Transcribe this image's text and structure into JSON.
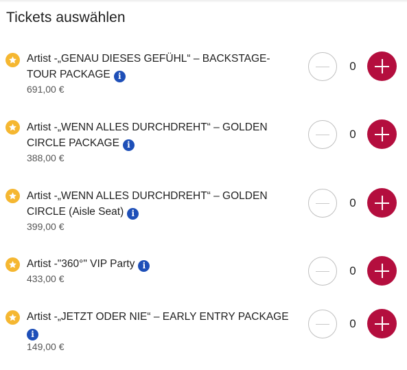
{
  "title": "Tickets auswählen",
  "tickets": [
    {
      "name": "Artist -„GENAU DIESES GEFÜHL“ – BACKSTAGE-TOUR PACKAGE",
      "price": "691,00 €",
      "quantity": "0"
    },
    {
      "name": "Artist -„WENN ALLES DURCHDREHT“ – GOLDEN CIRCLE PACKAGE",
      "price": "388,00 €",
      "quantity": "0"
    },
    {
      "name": "Artist -„WENN ALLES DURCHDREHT“ – GOLDEN CIRCLE (Aisle Seat)",
      "price": "399,00 €",
      "quantity": "0"
    },
    {
      "name": "Artist -\"360°\" VIP Party",
      "price": "433,00 €",
      "quantity": "0"
    },
    {
      "name": "Artist -„JETZT ODER NIE“ – EARLY ENTRY PACKAGE",
      "price": "149,00 €",
      "quantity": "0"
    }
  ],
  "icons": {
    "star": "star-icon",
    "info": "info-icon",
    "info_glyph": "i",
    "minus": "minus-icon",
    "plus": "plus-icon"
  },
  "colors": {
    "star_badge": "#f5b731",
    "info_badge": "#1e4fb8",
    "plus_button": "#b40e3e",
    "minus_border": "#bfbfbf"
  }
}
